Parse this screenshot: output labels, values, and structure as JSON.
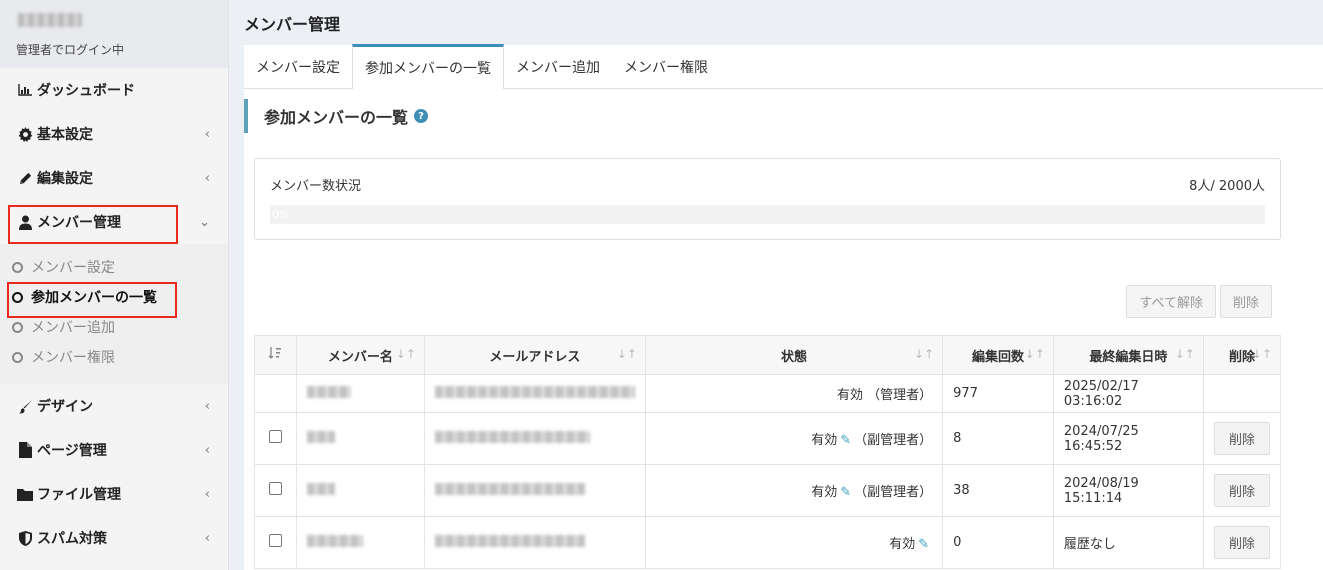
{
  "user": {
    "status": "管理者でログイン中"
  },
  "menu": {
    "dashboard": "ダッシュボード",
    "basic": "基本設定",
    "edit": "編集設定",
    "member": "メンバー管理",
    "design": "デザイン",
    "page": "ページ管理",
    "file": "ファイル管理",
    "spam": "スパム対策"
  },
  "submenu": [
    "メンバー設定",
    "参加メンバーの一覧",
    "メンバー追加",
    "メンバー権限"
  ],
  "header": {
    "title": "メンバー管理"
  },
  "tabs": [
    "メンバー設定",
    "参加メンバーの一覧",
    "メンバー追加",
    "メンバー権限"
  ],
  "section": {
    "title": "参加メンバーの一覧"
  },
  "status": {
    "label": "メンバー数状況",
    "count": "8人/ 2000人",
    "progress_text": "0%",
    "progress": 0
  },
  "buttons": {
    "clear_all": "すべて解除",
    "delete": "削除"
  },
  "table": {
    "headers": [
      "メンバー名",
      "メールアドレス",
      "状態",
      "編集回数",
      "最終編集日時",
      "削除"
    ],
    "rows": [
      {
        "status": "有効 （管理者）",
        "edits": "977",
        "last": "2025/02/17 03:16:02",
        "delete": ""
      },
      {
        "status": "有効",
        "role": "（副管理者）",
        "edits": "8",
        "last": "2024/07/25 16:45:52",
        "delete": "削除"
      },
      {
        "status": "有効",
        "role": "（副管理者）",
        "edits": "38",
        "last": "2024/08/19 15:11:14",
        "delete": "削除"
      },
      {
        "status": "有効",
        "role": "",
        "edits": "0",
        "last": "履歴なし",
        "delete": "削除"
      }
    ]
  },
  "colors": {
    "accent": "#3c8dbc",
    "highlight": "#e8291c",
    "section_bar": "#5fa2b5"
  }
}
